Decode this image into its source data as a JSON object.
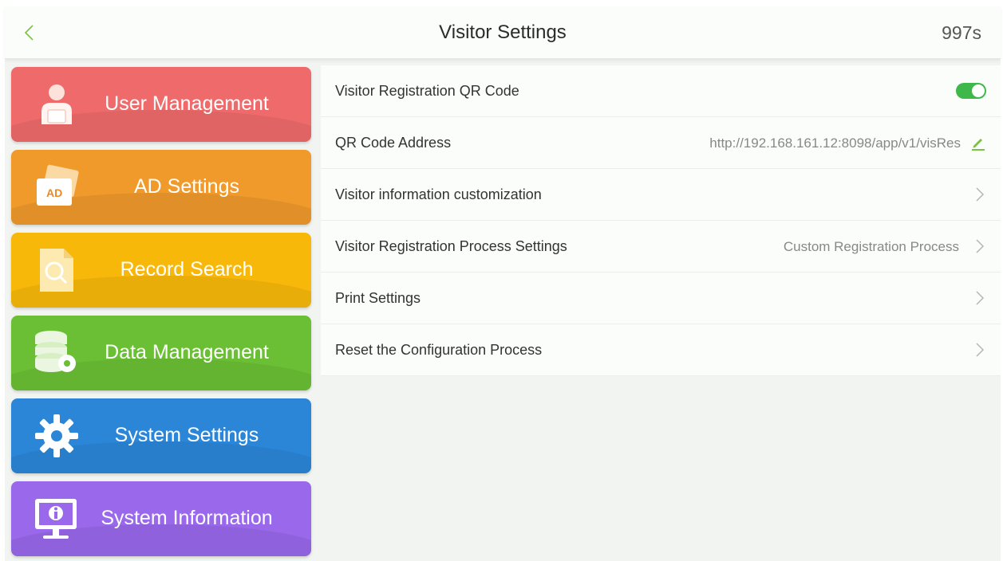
{
  "header": {
    "title": "Visitor Settings",
    "timer": "997s",
    "back_icon": "chevron-left-icon"
  },
  "sidebar": {
    "items": [
      {
        "label": "User Management",
        "icon": "user-icon",
        "color": "#ef6b6b"
      },
      {
        "label": "AD Settings",
        "icon": "ad-card-icon",
        "icon_text": "AD",
        "color": "#f09a2c"
      },
      {
        "label": "Record Search",
        "icon": "document-search-icon",
        "color": "#f8b80a"
      },
      {
        "label": "Data Management",
        "icon": "database-gear-icon",
        "color": "#6bbf35"
      },
      {
        "label": "System Settings",
        "icon": "gear-icon",
        "color": "#2b86d8"
      },
      {
        "label": "System Information",
        "icon": "monitor-info-icon",
        "color": "#9a68ea"
      }
    ]
  },
  "settings": {
    "rows": [
      {
        "label": "Visitor Registration QR Code",
        "control": "toggle",
        "toggle_on": true
      },
      {
        "label": "QR Code Address",
        "value": "http://192.168.161.12:8098/app/v1/visRes",
        "control": "edit-icon"
      },
      {
        "label": "Visitor information customization",
        "control": "chevron-right-icon"
      },
      {
        "label": "Visitor Registration Process Settings",
        "value": "Custom Registration Process",
        "control": "chevron-right-icon"
      },
      {
        "label": "Print Settings",
        "control": "chevron-right-icon"
      },
      {
        "label": "Reset the Configuration Process",
        "control": "chevron-right-icon"
      }
    ]
  },
  "colors": {
    "accent_green": "#3fb84b",
    "edit_icon": "#7cc242"
  }
}
